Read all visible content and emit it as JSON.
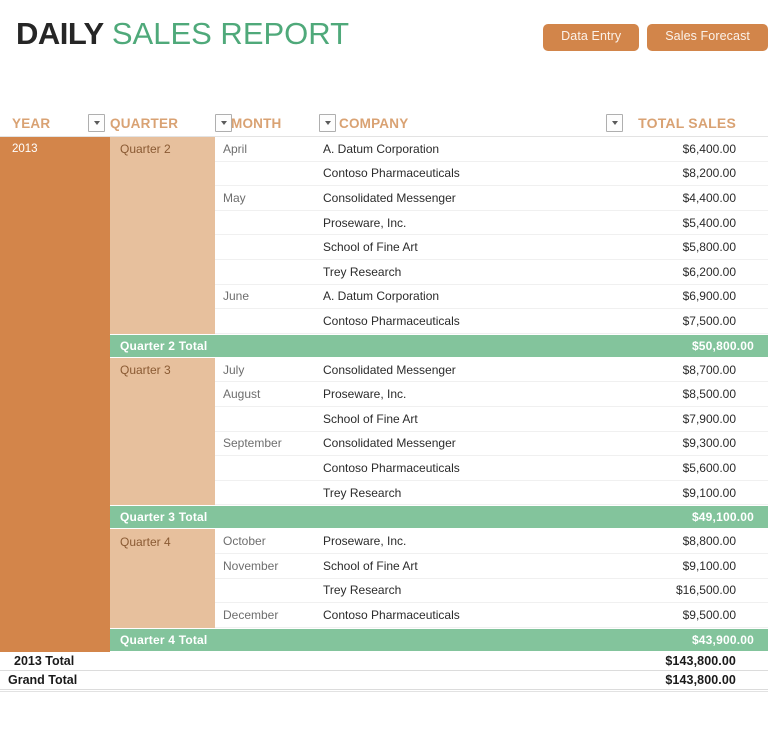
{
  "header": {
    "title_bold": "DAILY",
    "title_light": "SALES REPORT",
    "buttons": [
      {
        "label": "Data Entry",
        "name": "data-entry-button"
      },
      {
        "label": "Sales Forecast",
        "name": "sales-forecast-button"
      }
    ],
    "accent_orange": "#D2854A",
    "accent_green": "#4FA97A"
  },
  "table": {
    "columns": {
      "year": "YEAR",
      "quarter": "QUARTER",
      "month": "MONTH",
      "company": "COMPANY",
      "total": "TOTAL SALES"
    },
    "filter_icon": "chevron-down-icon",
    "year_label": "2013",
    "groups": [
      {
        "quarter": "Quarter 2",
        "rows": [
          {
            "month": "April",
            "company": "A. Datum Corporation",
            "total": "$6,400.00"
          },
          {
            "month": "",
            "company": "Contoso Pharmaceuticals",
            "total": "$8,200.00"
          },
          {
            "month": "May",
            "company": "Consolidated Messenger",
            "total": "$4,400.00"
          },
          {
            "month": "",
            "company": "Proseware, Inc.",
            "total": "$5,400.00"
          },
          {
            "month": "",
            "company": "School of Fine Art",
            "total": "$5,800.00"
          },
          {
            "month": "",
            "company": "Trey Research",
            "total": "$6,200.00"
          },
          {
            "month": "June",
            "company": "A. Datum Corporation",
            "total": "$6,900.00"
          },
          {
            "month": "",
            "company": "Contoso Pharmaceuticals",
            "total": "$7,500.00"
          }
        ],
        "total_label": "Quarter 2 Total",
        "total_value": "$50,800.00"
      },
      {
        "quarter": "Quarter 3",
        "rows": [
          {
            "month": "July",
            "company": "Consolidated Messenger",
            "total": "$8,700.00"
          },
          {
            "month": "August",
            "company": "Proseware, Inc.",
            "total": "$8,500.00"
          },
          {
            "month": "",
            "company": "School of Fine Art",
            "total": "$7,900.00"
          },
          {
            "month": "September",
            "company": "Consolidated Messenger",
            "total": "$9,300.00"
          },
          {
            "month": "",
            "company": "Contoso Pharmaceuticals",
            "total": "$5,600.00"
          },
          {
            "month": "",
            "company": "Trey Research",
            "total": "$9,100.00"
          }
        ],
        "total_label": "Quarter 3 Total",
        "total_value": "$49,100.00"
      },
      {
        "quarter": "Quarter 4",
        "rows": [
          {
            "month": "October",
            "company": "Proseware, Inc.",
            "total": "$8,800.00"
          },
          {
            "month": "November",
            "company": "School of Fine Art",
            "total": "$9,100.00"
          },
          {
            "month": "",
            "company": "Trey Research",
            "total": "$16,500.00"
          },
          {
            "month": "December",
            "company": "Contoso Pharmaceuticals",
            "total": "$9,500.00"
          }
        ],
        "total_label": "Quarter 4 Total",
        "total_value": "$43,900.00"
      }
    ],
    "grand_totals": [
      {
        "label": "2013 Total",
        "value": "$143,800.00"
      },
      {
        "label": "Grand Total",
        "value": "$143,800.00"
      }
    ],
    "colors": {
      "year_fill": "#D3854A",
      "quarter_fill": "#E7C09D",
      "total_row_fill": "#83C49C",
      "header_text": "#D9A273"
    }
  }
}
